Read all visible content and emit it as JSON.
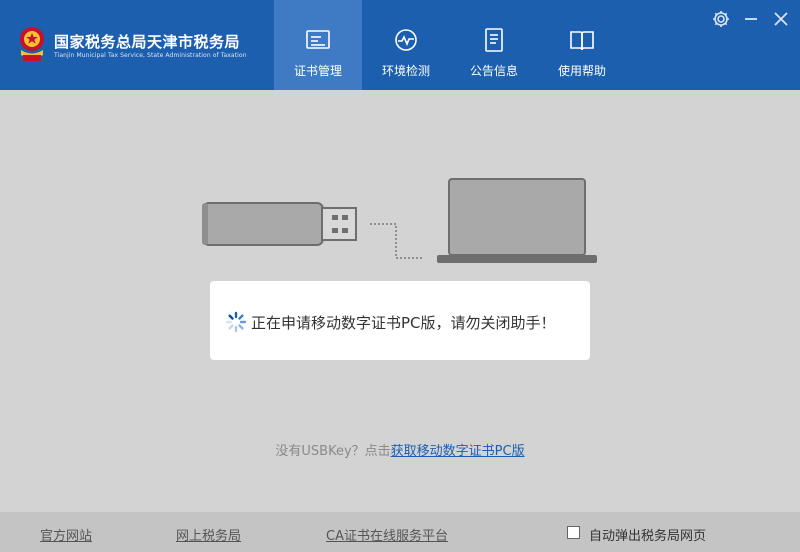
{
  "header": {
    "title": "国家税务总局天津市税务局",
    "subtitle": "Tianjin Municipal Tax Service, State Administration of Taxation",
    "logo_icon": "tax-emblem-icon",
    "tabs": [
      {
        "label": "证书管理",
        "icon": "certificate-icon",
        "active": true
      },
      {
        "label": "环境检测",
        "icon": "gauge-icon",
        "active": false
      },
      {
        "label": "公告信息",
        "icon": "document-icon",
        "active": false
      },
      {
        "label": "使用帮助",
        "icon": "book-icon",
        "active": false
      }
    ],
    "window_controls": [
      "gear-icon",
      "minimize-icon",
      "close-icon"
    ]
  },
  "dialog": {
    "message": "正在申请移动数字证书PC版，请勿关闭助手！",
    "icon": "loading-spinner-icon"
  },
  "usbkey": {
    "prefix": "没有USBKey？点击",
    "link": "获取移动数字证书PC版"
  },
  "footer": {
    "links": [
      "官方网站",
      "网上税务局",
      "CA证书在线服务平台"
    ],
    "checkbox_label": "自动弹出税务局网页",
    "checkbox_checked": false
  },
  "colors": {
    "header_bg": "#1b5fae",
    "active_tab_bg": "#3f7bc4",
    "body_bg": "#d3d3d3",
    "footer_bg": "#c4c4c4",
    "link": "#1a5fb4"
  }
}
